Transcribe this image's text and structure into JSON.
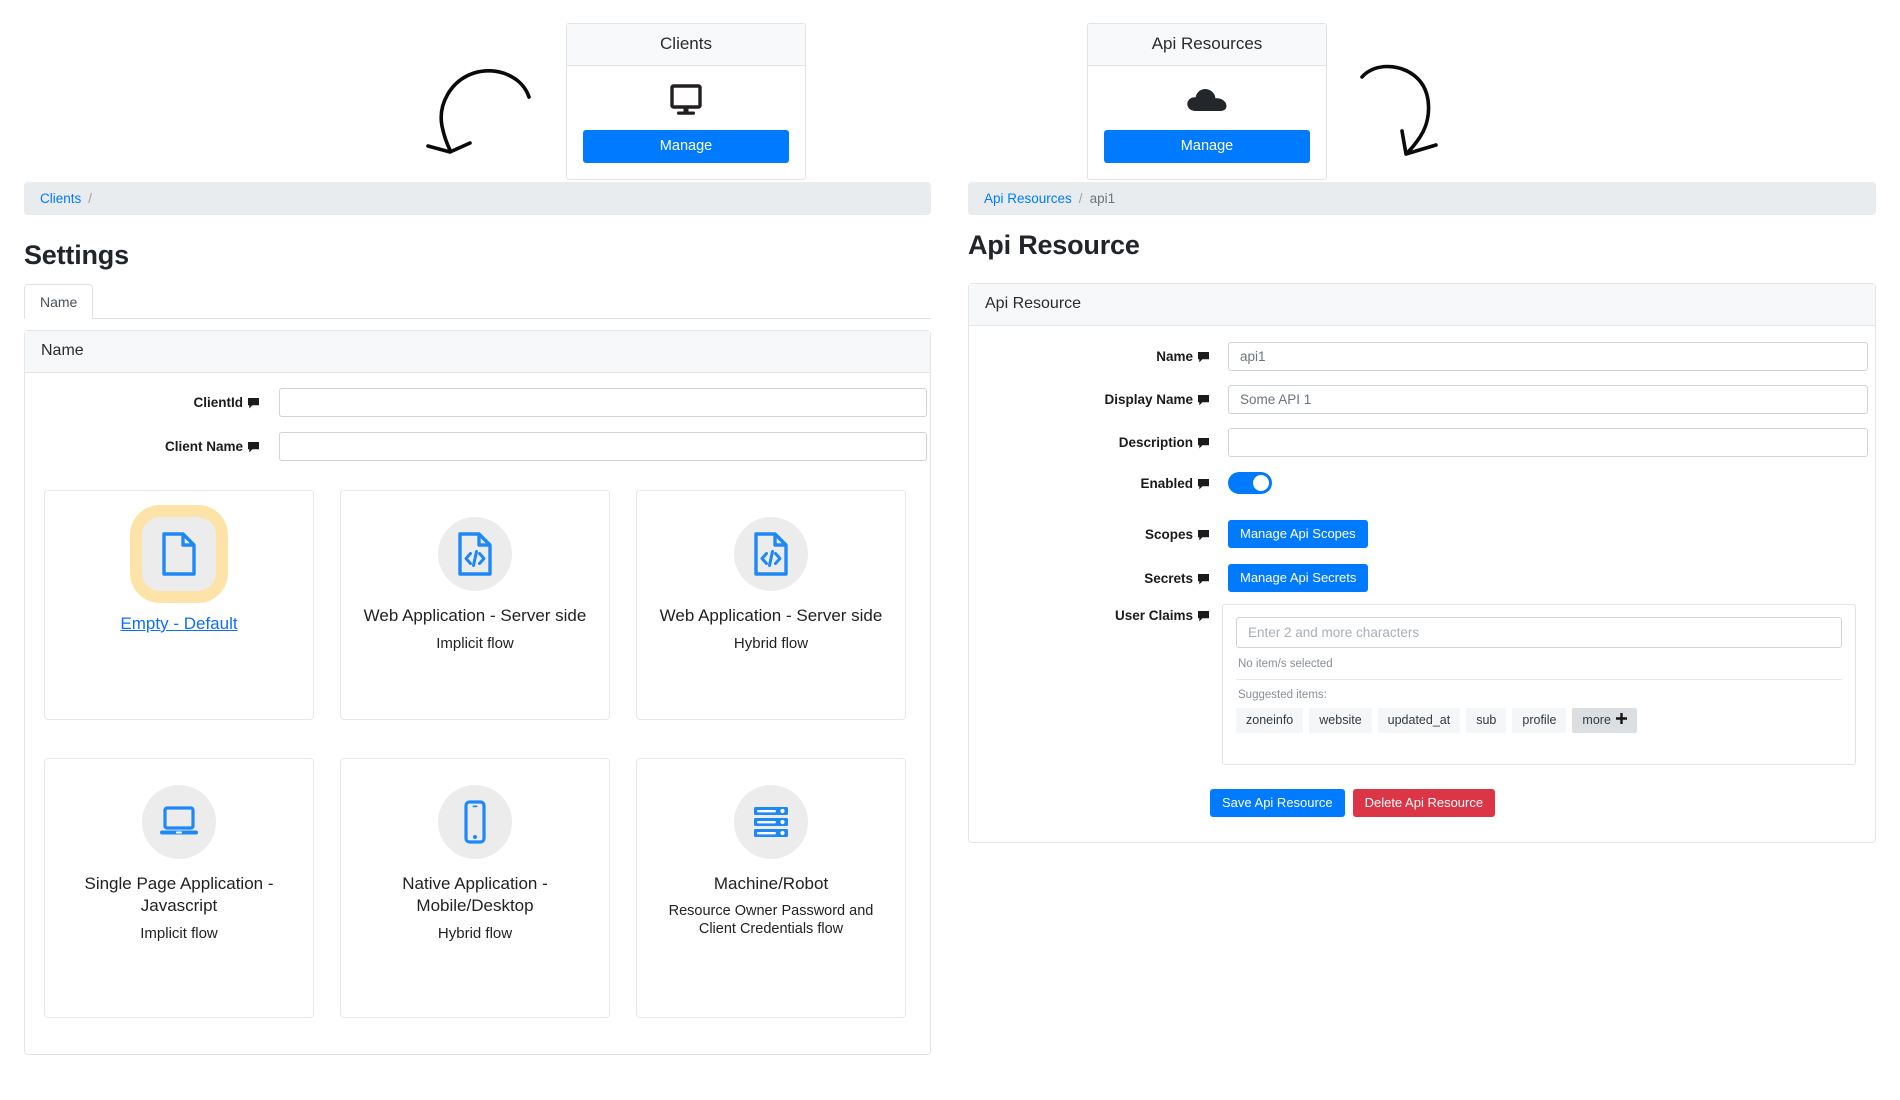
{
  "promo": {
    "clients": {
      "title": "Clients",
      "icon": "monitor-icon",
      "button": "Manage"
    },
    "api_resources": {
      "title": "Api Resources",
      "icon": "cloud-icon",
      "button": "Manage"
    }
  },
  "left": {
    "breadcrumb": {
      "root": "Clients",
      "separator": "/"
    },
    "page_title": "Settings",
    "tabs": [
      {
        "label": "Name",
        "active": true
      }
    ],
    "card_header": "Name",
    "fields": [
      {
        "label": "ClientId",
        "value": "",
        "placeholder": ""
      },
      {
        "label": "Client Name",
        "value": "",
        "placeholder": ""
      }
    ],
    "tiles": [
      {
        "name": "empty-default",
        "icon": "document-icon",
        "title": "Empty - Default",
        "sub": "",
        "link": true,
        "highlight": true
      },
      {
        "name": "web-app-server-implicit",
        "icon": "code-file-icon",
        "title": "Web Application - Server side",
        "sub": "Implicit flow",
        "link": false,
        "highlight": false
      },
      {
        "name": "web-app-server-hybrid",
        "icon": "code-file-icon",
        "title": "Web Application - Server side",
        "sub": "Hybrid flow",
        "link": false,
        "highlight": false
      },
      {
        "name": "single-page-app-javascript",
        "icon": "laptop-icon",
        "title": "Single Page Application - Javascript",
        "sub": "Implicit flow",
        "link": false,
        "highlight": false
      },
      {
        "name": "native-app-mobile-desktop",
        "icon": "mobile-icon",
        "title": "Native Application - Mobile/Desktop",
        "sub": "Hybrid flow",
        "link": false,
        "highlight": false
      },
      {
        "name": "machine-robot",
        "icon": "server-rack-icon",
        "title": "Machine/Robot",
        "sub": "Resource Owner Password and Client Credentials flow",
        "link": false,
        "highlight": false
      }
    ]
  },
  "right": {
    "breadcrumb": {
      "root": "Api Resources",
      "separator": "/",
      "current": "api1"
    },
    "page_title": "Api Resource",
    "card_header": "Api Resource",
    "fields": {
      "name": {
        "label": "Name",
        "value": "api1"
      },
      "display_name": {
        "label": "Display Name",
        "value": "Some API 1"
      },
      "description": {
        "label": "Description",
        "value": ""
      },
      "enabled": {
        "label": "Enabled",
        "on": true
      },
      "scopes": {
        "label": "Scopes",
        "button": "Manage Api Scopes"
      },
      "secrets": {
        "label": "Secrets",
        "button": "Manage Api Secrets"
      },
      "user_claims": {
        "label": "User Claims"
      }
    },
    "user_claims": {
      "placeholder": "Enter 2 and more characters",
      "value": "",
      "selected_note": "No item/s selected",
      "suggested_label": "Suggested items:",
      "chips": [
        "zoneinfo",
        "website",
        "updated_at",
        "sub",
        "profile"
      ],
      "more_label": "more"
    },
    "actions": {
      "save": "Save Api Resource",
      "delete": "Delete Api Resource"
    }
  },
  "colors": {
    "primary": "#007bff",
    "danger": "#dc3545",
    "link": "#0d6efd",
    "highlight": "#fde3a7",
    "breadcrumb_bg": "#e9ecef"
  }
}
